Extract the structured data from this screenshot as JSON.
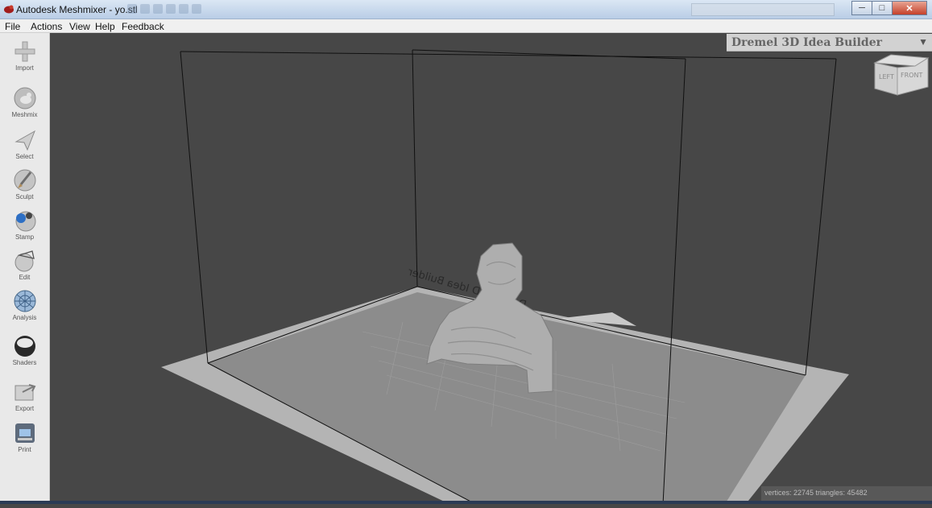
{
  "window": {
    "title": "Autodesk Meshmixer - yo.stl",
    "controls": {
      "minimize_icon": "minimize-icon",
      "maximize_icon": "maximize-icon",
      "close_icon": "close-icon"
    }
  },
  "menu": [
    "File",
    "Actions",
    "View",
    "Help",
    "Feedback"
  ],
  "tools": [
    {
      "label": "Import",
      "icon": "plus-icon"
    },
    {
      "label": "Meshmix",
      "icon": "meshmix-bunny-icon"
    },
    {
      "label": "Select",
      "icon": "cursor-arrow-icon"
    },
    {
      "label": "Sculpt",
      "icon": "brush-icon"
    },
    {
      "label": "Stamp",
      "icon": "stamp-icon"
    },
    {
      "label": "Edit",
      "icon": "edit-sphere-icon"
    },
    {
      "label": "Analysis",
      "icon": "analysis-sphere-icon"
    },
    {
      "label": "Shaders",
      "icon": "shader-sphere-icon"
    },
    {
      "label": "Export",
      "icon": "export-icon"
    },
    {
      "label": "Print",
      "icon": "printer-icon"
    }
  ],
  "printer": {
    "selected": "Dremel 3D Idea Builder"
  },
  "bed_label": "Dremel 3D Idea Builder",
  "viewcube": {
    "left": "LEFT",
    "front": "FRONT"
  },
  "status": {
    "text": "vertices: 22745 triangles: 45482"
  },
  "colors": {
    "viewport_bg": "#474747",
    "toolbar_bg": "#e9e9e9",
    "bed": "#8c8c8c",
    "bed_border": "#b4b4b4",
    "model": "#aeaeae"
  }
}
